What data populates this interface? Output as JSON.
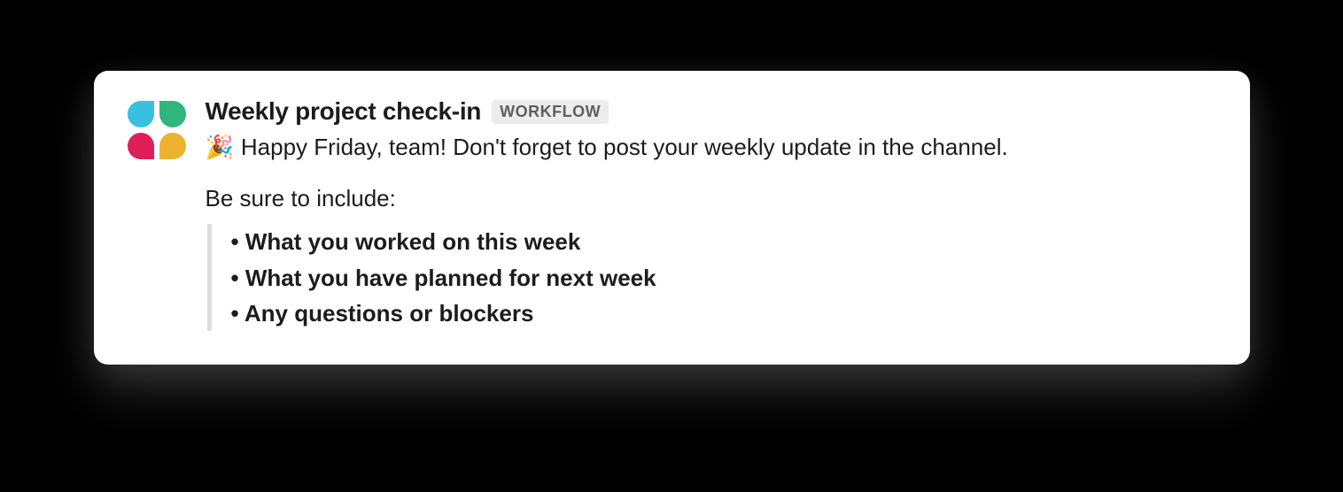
{
  "message": {
    "title": "Weekly project check-in",
    "badge": "WORKFLOW",
    "emoji": "🎉",
    "intro_text": "Happy Friday, team! Don't forget to post your weekly update in the channel.",
    "subhead": "Be sure to include:",
    "bullets": [
      "What you worked on this week",
      "What you have planned for next week",
      "Any questions or blockers"
    ],
    "avatar_colors": {
      "tl": "#39bfe0",
      "tr": "#2eb67d",
      "bl": "#e01e5a",
      "br": "#ecb22e"
    }
  }
}
